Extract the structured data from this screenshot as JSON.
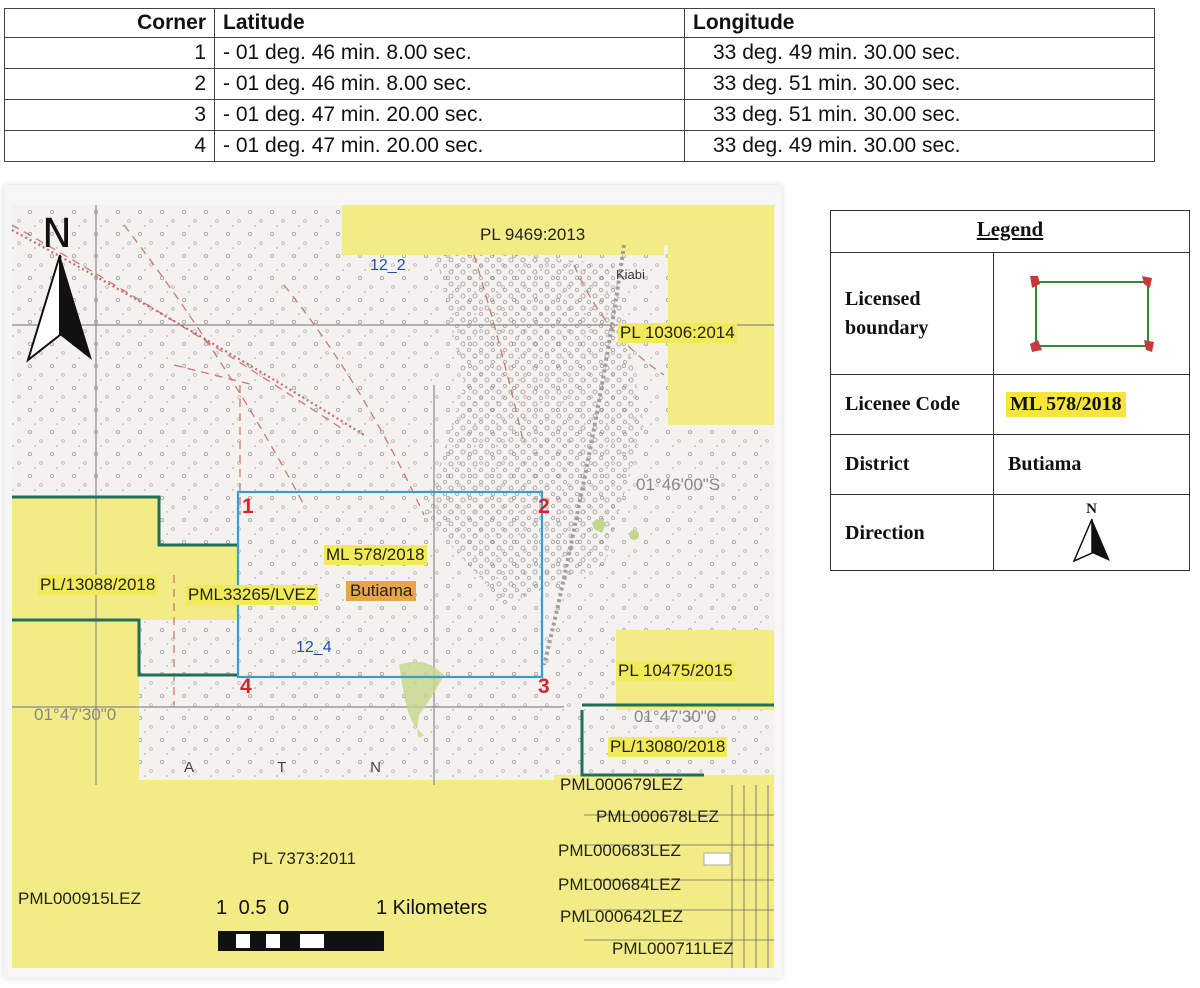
{
  "table": {
    "headers": {
      "corner": "Corner",
      "latitude": "Latitude",
      "longitude": "Longitude"
    },
    "rows": [
      {
        "corner": "1",
        "latitude": "- 01 deg. 46 min. 8.00 sec.",
        "longitude": "33 deg. 49 min. 30.00 sec."
      },
      {
        "corner": "2",
        "latitude": "- 01 deg. 46 min. 8.00 sec.",
        "longitude": "33 deg. 51 min. 30.00 sec."
      },
      {
        "corner": "3",
        "latitude": "- 01 deg. 47 min. 20.00 sec.",
        "longitude": "33 deg. 51 min. 30.00 sec."
      },
      {
        "corner": "4",
        "latitude": "- 01 deg. 47 min. 20.00 sec.",
        "longitude": "33 deg. 49 min. 30.00 sec."
      }
    ]
  },
  "map": {
    "north_letter": "N",
    "license_areas": {
      "pl_9469": "PL 9469:2013",
      "pl_10306": "PL 10306:2014",
      "pl_13088": "PL/13088/2018",
      "pml_33265": "PML33265/LVEZ",
      "ml_578": "ML 578/2018",
      "pl_10475": "PL 10475/2015",
      "pl_13080": "PL/13080/2018",
      "pl_7373": "PL 7373:2011",
      "pml_915": "PML000915LEZ",
      "pml_679": "PML000679LEZ",
      "pml_678": "PML000678LEZ",
      "pml_683": "PML000683LEZ",
      "pml_684": "PML000684LEZ",
      "pml_642": "PML000642LEZ",
      "pml_711": "PML000711LEZ"
    },
    "place_name": "Butiama",
    "grid_labels": {
      "g12_2": "12_2",
      "g12_4": "12_4"
    },
    "corner_numbers": [
      "1",
      "2",
      "3",
      "4"
    ],
    "coordinate_labels": {
      "lat_01_46": "01°46'00\"S",
      "lat_01_47": "01°47'30\"0",
      "lat_01_47_right": "01°47'30\"0"
    },
    "topo_texts": {
      "kiabi": "Kiabi",
      "bottom": "A T N"
    },
    "scale": {
      "ticks": "1 0.5 0",
      "end": "1 Kilometers"
    },
    "colors": {
      "license_fill": "#f3ec86",
      "license_boundary": "#3a9ec8",
      "pml_boundary": "#1f6f5a",
      "corner_marker": "#d8242c"
    }
  },
  "legend": {
    "title": "Legend",
    "rows": [
      {
        "key": "Licensed boundary",
        "value": ""
      },
      {
        "key": "Licenee Code",
        "value": "ML 578/2018"
      },
      {
        "key": "District",
        "value": "Butiama"
      },
      {
        "key": "Direction",
        "value": "N"
      }
    ]
  }
}
